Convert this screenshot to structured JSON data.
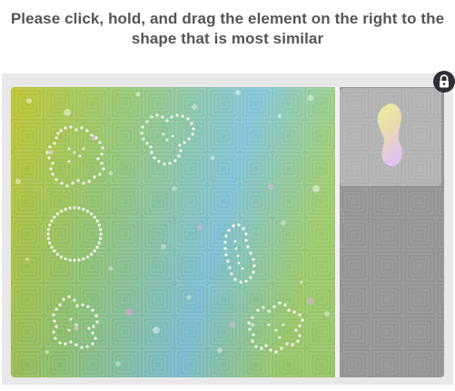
{
  "captcha": {
    "instruction": "Please click, hold, and drag the element on the right to the shape that is most similar",
    "colors": {
      "gradient_left": "#b5c12a",
      "gradient_mid": "#7fc48a",
      "gradient_blue": "#7cc2d6",
      "gradient_right": "#a9cf5a",
      "right_panel": "#9d9d9d",
      "frame": "#e8e8e8",
      "lock_button": "#2e2e36",
      "piece_yellow": "#efef9a",
      "piece_pink": "#e6c6f2"
    },
    "icons": {
      "lock": "lock-icon"
    },
    "shapes": [
      {
        "name": "cross-flower",
        "type": "target"
      },
      {
        "name": "three-lobe-cloud",
        "type": "target"
      },
      {
        "name": "circle",
        "type": "target"
      },
      {
        "name": "footprint-oval",
        "type": "target"
      },
      {
        "name": "clover-swirl",
        "type": "target"
      },
      {
        "name": "star-blob",
        "type": "target"
      }
    ],
    "drag_element": {
      "name": "footprint-piece"
    }
  }
}
